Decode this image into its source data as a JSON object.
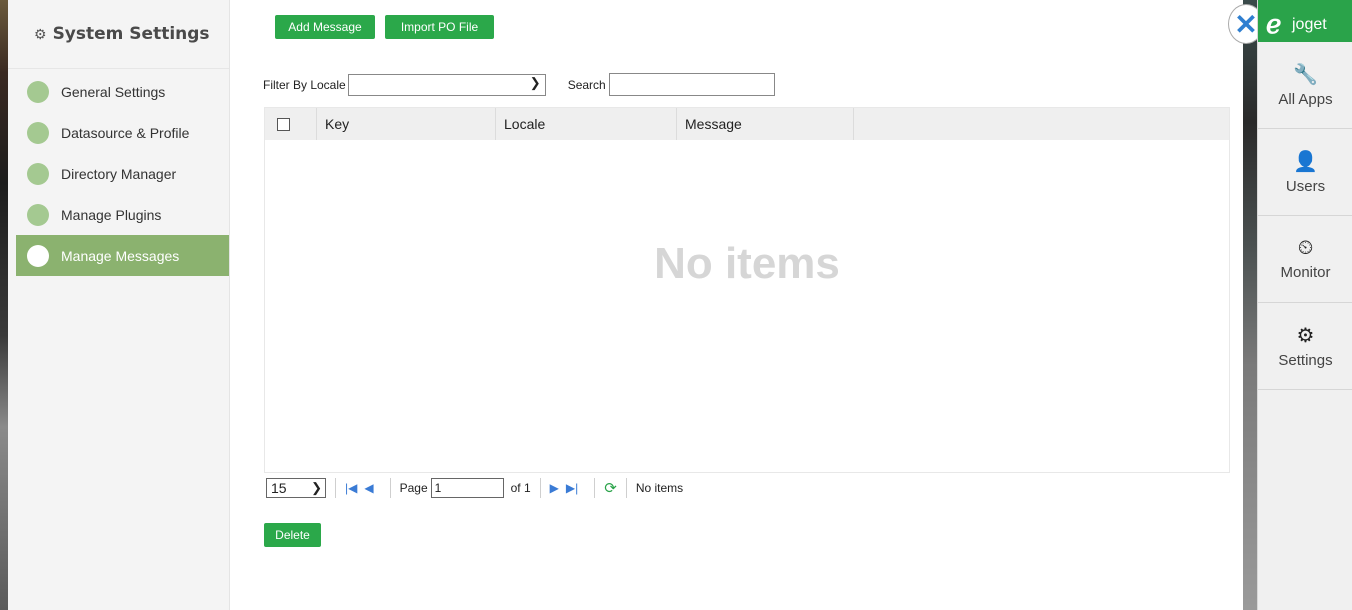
{
  "sidebar": {
    "title": "System Settings",
    "items": [
      {
        "label": "General Settings"
      },
      {
        "label": "Datasource & Profile"
      },
      {
        "label": "Directory Manager"
      },
      {
        "label": "Manage Plugins"
      },
      {
        "label": "Manage Messages"
      }
    ]
  },
  "toolbar": {
    "add_label": "Add Message",
    "import_label": "Import PO File"
  },
  "filter": {
    "locale_label": "Filter By Locale",
    "locale_value": "",
    "search_label": "Search",
    "search_value": ""
  },
  "grid": {
    "columns": [
      "Key",
      "Locale",
      "Message"
    ],
    "empty_text": "No items"
  },
  "pager": {
    "page_size": "15",
    "page_label": "Page",
    "page_value": "1",
    "of_label": "of 1",
    "status": "No items"
  },
  "actions": {
    "delete_label": "Delete"
  },
  "rail": {
    "logo_text": "joget",
    "items": [
      {
        "label": "All Apps",
        "icon": "wrench-icon"
      },
      {
        "label": "Users",
        "icon": "user-icon"
      },
      {
        "label": "Monitor",
        "icon": "dashboard-icon"
      },
      {
        "label": "Settings",
        "icon": "gears-icon"
      }
    ]
  }
}
